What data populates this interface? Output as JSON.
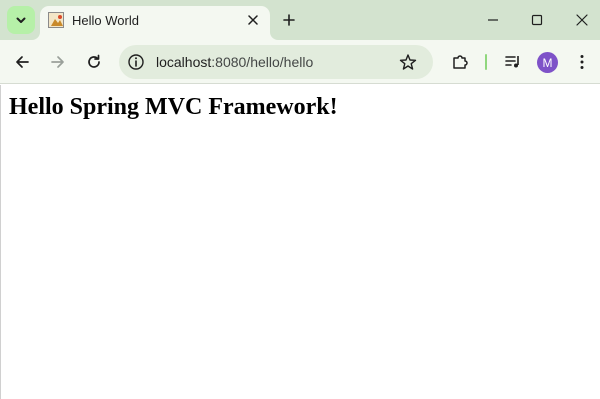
{
  "browser": {
    "tab": {
      "title": "Hello World"
    },
    "address_bar": {
      "host": "localhost",
      "path": ":8080/hello/hello"
    },
    "profile": {
      "initial": "M"
    }
  },
  "page": {
    "heading": "Hello Spring MVC Framework!"
  },
  "icons": {
    "tab_search": "chevron-down-icon",
    "favicon": "page-favicon",
    "tab_close": "close-icon",
    "new_tab": "plus-icon",
    "minimize": "minimize-icon",
    "maximize": "maximize-icon",
    "close_window": "close-icon",
    "back": "arrow-left-icon",
    "forward": "arrow-right-icon",
    "reload": "reload-icon",
    "site_info": "info-icon",
    "bookmark": "star-icon",
    "extensions": "puzzle-icon",
    "media": "media-queue-icon",
    "menu": "kebab-icon"
  },
  "colors": {
    "tabstrip_bg": "#d3e3cf",
    "toolbar_bg": "#f4f8f1",
    "omnibox_bg": "#e2ecdd",
    "accent_green": "#b6f0a8",
    "avatar_bg": "#7e52c8"
  }
}
